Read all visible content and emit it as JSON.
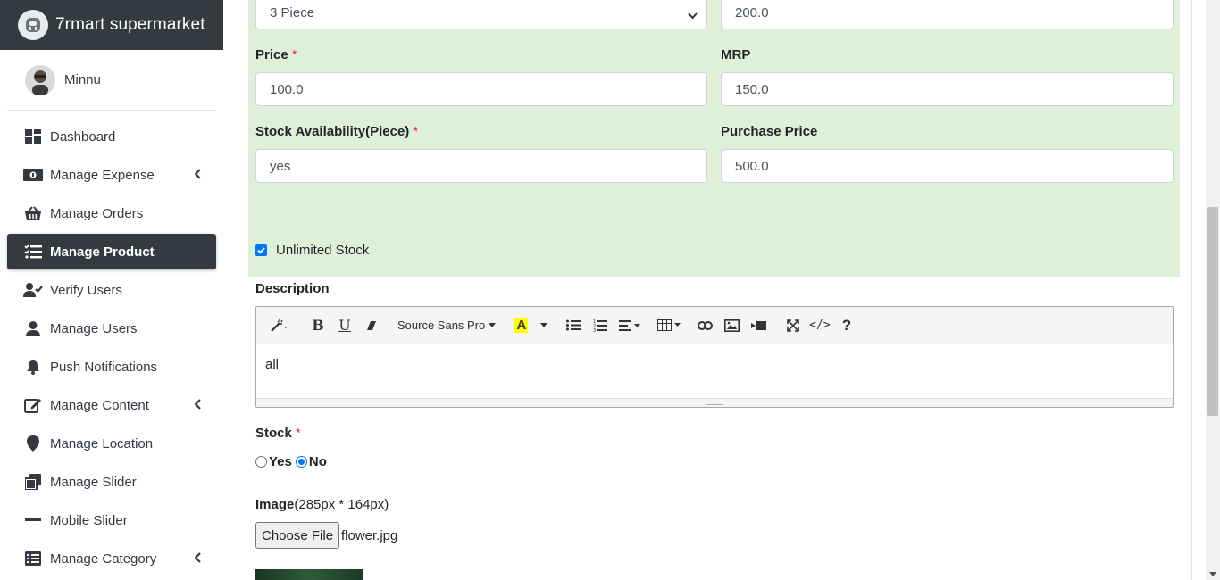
{
  "brand": {
    "name": "7rmart supermarket",
    "icon": "app-logo-icon"
  },
  "user": {
    "name": "Minnu"
  },
  "nav": [
    {
      "label": "Dashboard",
      "icon": "dashboard-icon",
      "chevron": false,
      "active": false
    },
    {
      "label": "Manage Expense",
      "icon": "money-icon",
      "chevron": true,
      "active": false
    },
    {
      "label": "Manage Orders",
      "icon": "basket-icon",
      "chevron": false,
      "active": false
    },
    {
      "label": "Manage Product",
      "icon": "list-check-icon",
      "chevron": false,
      "active": true
    },
    {
      "label": "Verify Users",
      "icon": "user-check-icon",
      "chevron": false,
      "active": false
    },
    {
      "label": "Manage Users",
      "icon": "user-icon",
      "chevron": false,
      "active": false
    },
    {
      "label": "Push Notifications",
      "icon": "bell-icon",
      "chevron": false,
      "active": false
    },
    {
      "label": "Manage Content",
      "icon": "edit-icon",
      "chevron": true,
      "active": false
    },
    {
      "label": "Manage Location",
      "icon": "map-marker-icon",
      "chevron": false,
      "active": false
    },
    {
      "label": "Manage Slider",
      "icon": "clone-icon",
      "chevron": false,
      "active": false
    },
    {
      "label": "Mobile Slider",
      "icon": "minus-icon",
      "chevron": false,
      "active": false
    },
    {
      "label": "Manage Category",
      "icon": "table-list-icon",
      "chevron": true,
      "active": false
    }
  ],
  "form": {
    "unit_select": "3 Piece",
    "weight_value": "200.0",
    "price": {
      "label": "Price",
      "value": "100.0"
    },
    "mrp": {
      "label": "MRP",
      "value": "150.0"
    },
    "stock_availability": {
      "label": "Stock Availability(Piece)",
      "value": "yes"
    },
    "purchase_price": {
      "label": "Purchase Price",
      "value": "500.0"
    },
    "unlimited_stock": {
      "label": "Unlimited Stock",
      "checked": true
    },
    "description": {
      "label": "Description",
      "content": "all",
      "font": "Source Sans Pro"
    },
    "stock": {
      "label": "Stock",
      "options": [
        "Yes",
        "No"
      ],
      "selected": "No"
    },
    "image": {
      "label": "Image",
      "hint": "(285px * 164px)",
      "button": "Choose File",
      "filename": "flower.jpg"
    },
    "required_mark": "*"
  },
  "colors": {
    "sidebar_dark": "#343a40",
    "form_green": "#dff0d8",
    "required": "#dc3545",
    "accent": "#0075ff"
  }
}
